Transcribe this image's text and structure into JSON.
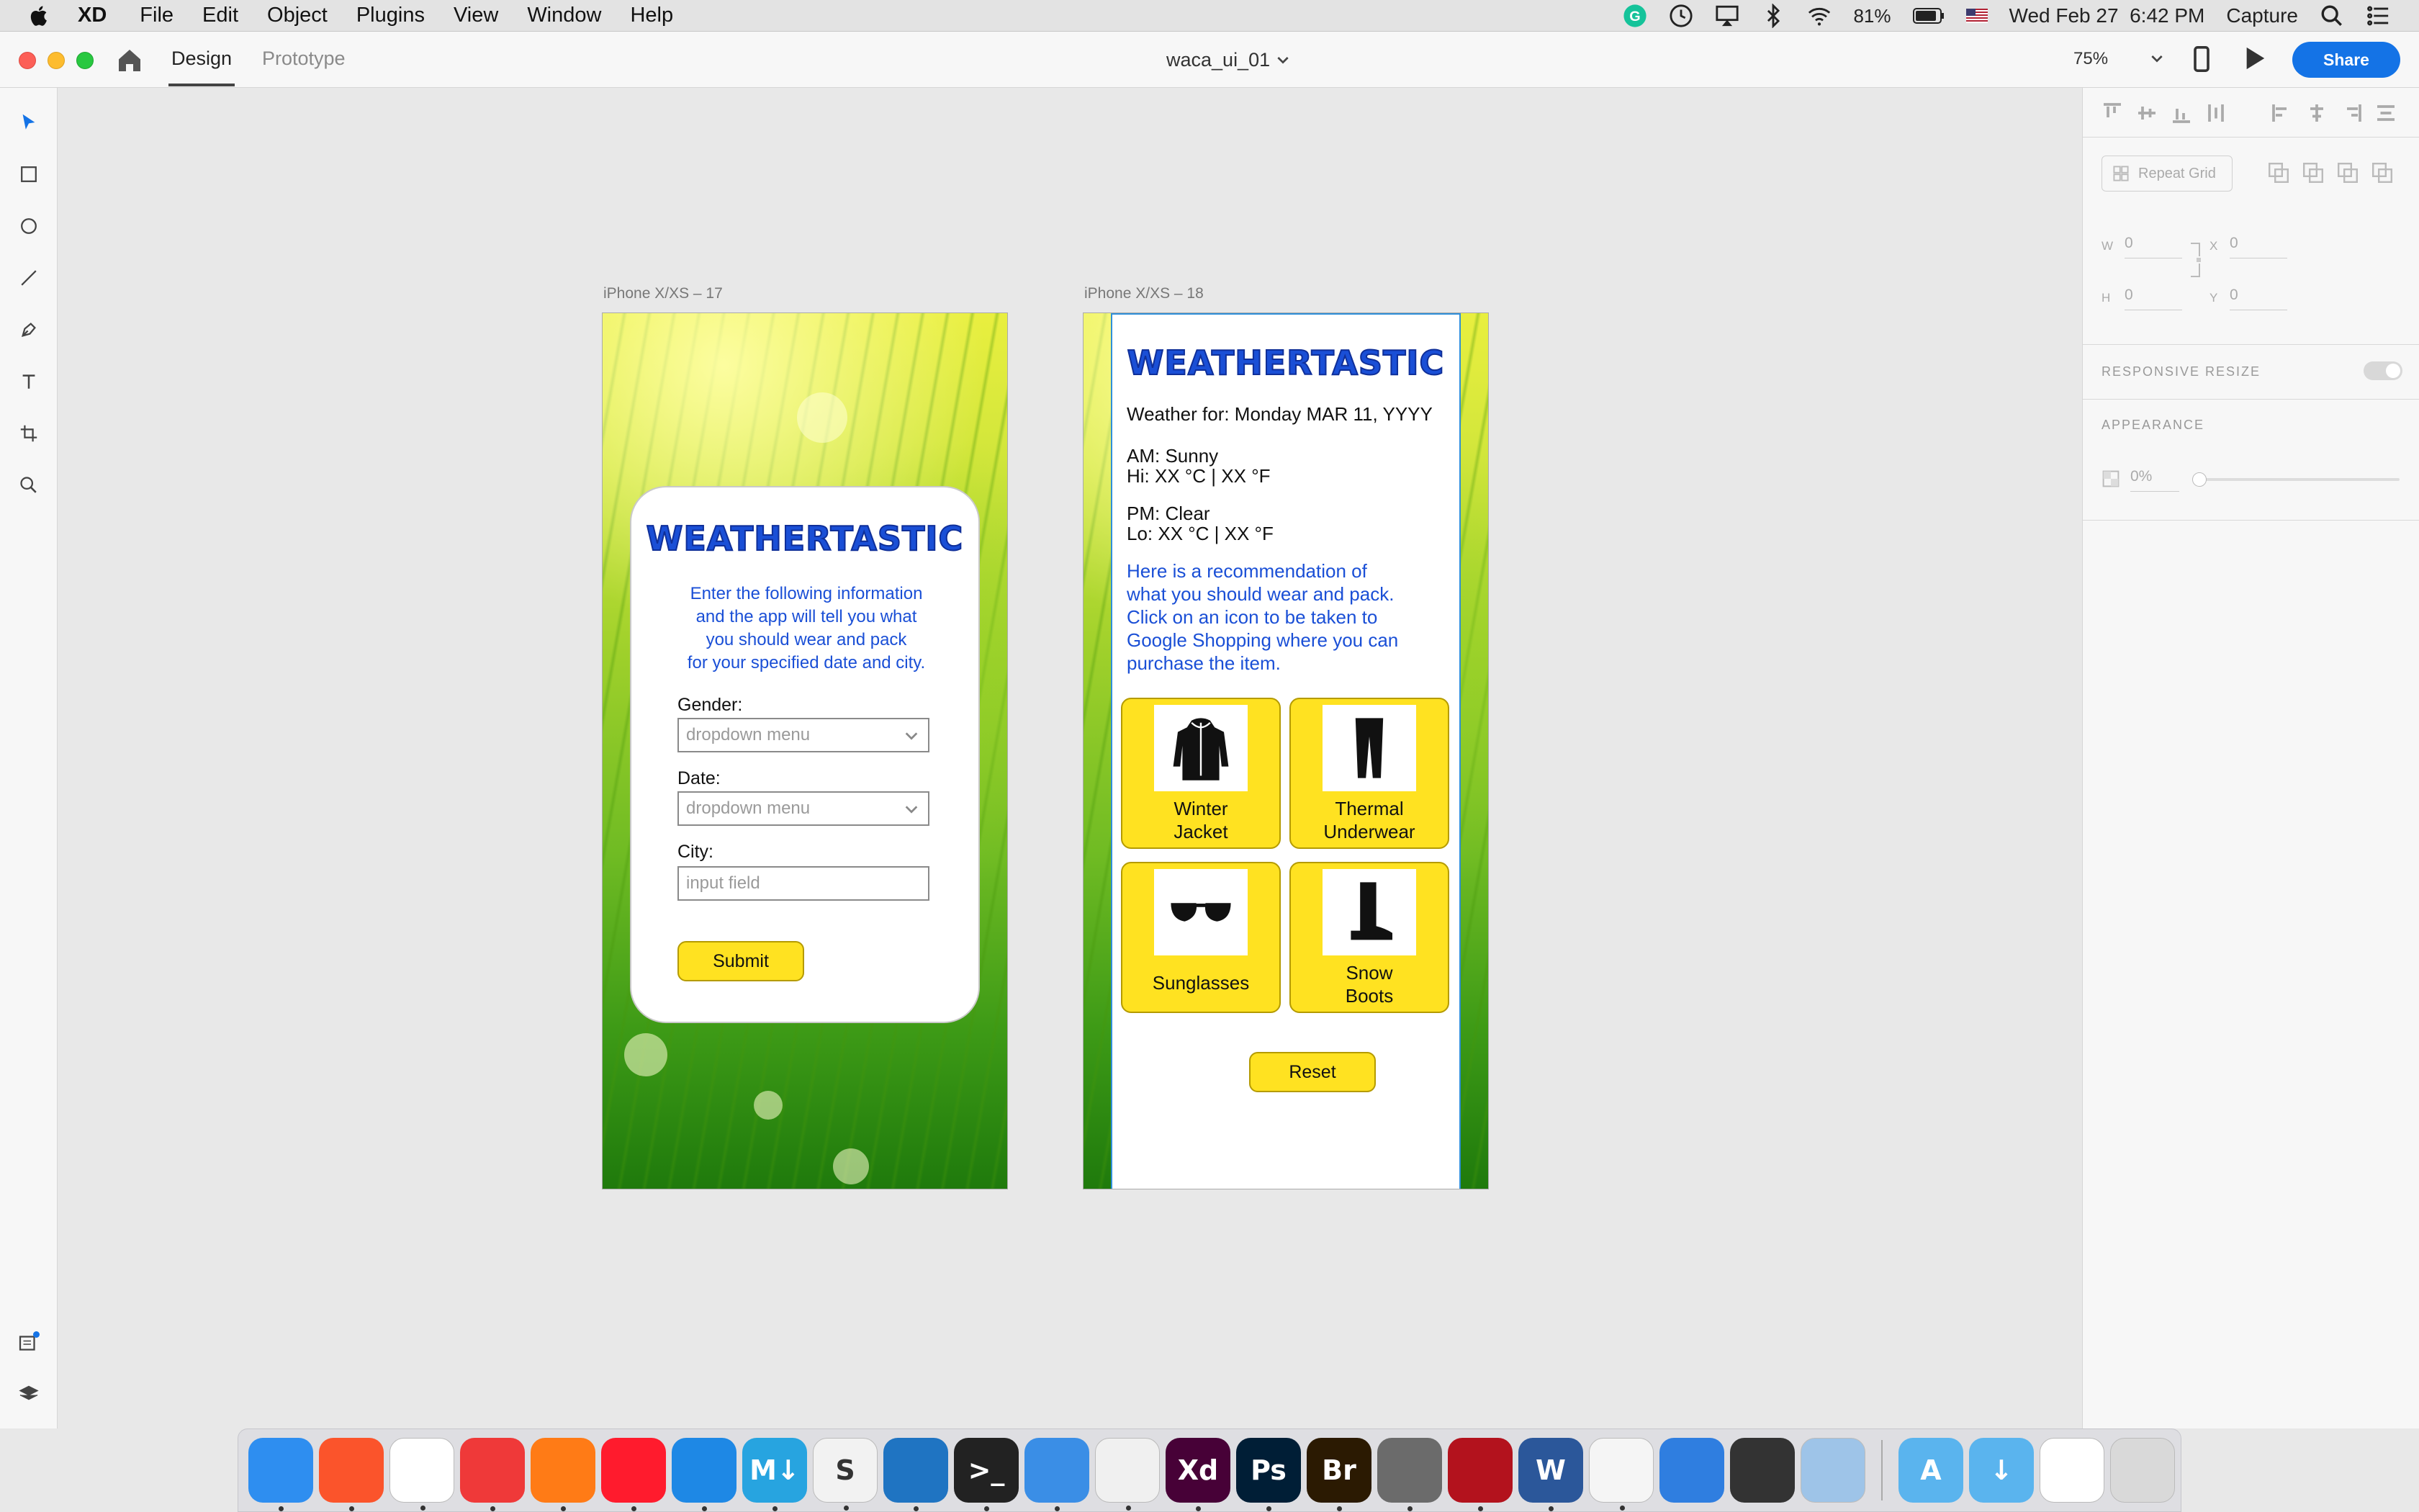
{
  "menubar": {
    "app_name": "XD",
    "menus": [
      "File",
      "Edit",
      "Object",
      "Plugins",
      "View",
      "Window",
      "Help"
    ],
    "battery": "81%",
    "datetime": "Wed Feb 27  6:42 PM",
    "capture_label": "Capture"
  },
  "titlebar": {
    "tab_design": "Design",
    "tab_prototype": "Prototype",
    "doc_title": "waca_ui_01",
    "zoom": "75%",
    "share_label": "Share"
  },
  "artboard1": {
    "label": "iPhone X/XS – 17",
    "logo": "WEATHERTASTIC",
    "intro": "Enter the following information\nand the app will tell you what\nyou should wear and pack\nfor your specified date and city.",
    "gender_label": "Gender:",
    "gender_value": "dropdown menu",
    "date_label": "Date:",
    "date_value": "dropdown menu",
    "city_label": "City:",
    "city_placeholder": "input field",
    "submit_label": "Submit"
  },
  "artboard2": {
    "label": "iPhone X/XS – 18",
    "logo": "WEATHERTASTIC",
    "weather_for": "Weather for: Monday MAR 11, YYYY",
    "am": "AM: Sunny\nHi: XX °C | XX °F",
    "pm": "PM: Clear\nLo: XX °C | XX °F",
    "recommendation": "Here is a recommendation of\nwhat you should wear and pack.\nClick on an icon to be taken to\nGoogle Shopping where you can\npurchase the item.",
    "items": [
      {
        "label": "Winter\nJacket",
        "icon": "jacket-icon"
      },
      {
        "label": "Thermal\nUnderwear",
        "icon": "leggings-icon"
      },
      {
        "label": "Sunglasses",
        "icon": "sunglasses-icon"
      },
      {
        "label": "Snow\nBoots",
        "icon": "boot-icon"
      }
    ],
    "reset_label": "Reset"
  },
  "props": {
    "repeat_grid": "Repeat Grid",
    "w_label": "W",
    "w_value": "0",
    "h_label": "H",
    "h_value": "0",
    "x_label": "X",
    "x_value": "0",
    "y_label": "Y",
    "y_value": "0",
    "responsive_resize": "RESPONSIVE RESIZE",
    "appearance": "APPEARANCE",
    "opacity_value": "0%"
  },
  "colors": {
    "accent_blue": "#1473e6",
    "logo_blue": "#1a4fd6",
    "button_yellow": "#ffe221"
  },
  "dock": {
    "apps": [
      {
        "name": "finder",
        "glyph": "",
        "color": "#2e8ef0"
      },
      {
        "name": "brave",
        "glyph": "",
        "color": "#fb542b"
      },
      {
        "name": "chrome",
        "glyph": "",
        "color": "#ffffff"
      },
      {
        "name": "vivaldi",
        "glyph": "",
        "color": "#ef3939"
      },
      {
        "name": "firefox",
        "glyph": "",
        "color": "#ff7b16"
      },
      {
        "name": "opera",
        "glyph": "",
        "color": "#ff1b2d"
      },
      {
        "name": "safari",
        "glyph": "",
        "color": "#1e88e5"
      },
      {
        "name": "markdown",
        "glyph": "M↓",
        "color": "#27a4e0"
      },
      {
        "name": "sublime",
        "glyph": "S",
        "color": "#f2f2f2"
      },
      {
        "name": "vscode",
        "glyph": "",
        "color": "#1f74c2"
      },
      {
        "name": "terminal",
        "glyph": ">_",
        "color": "#222222"
      },
      {
        "name": "xcode",
        "glyph": "",
        "color": "#3a8ee6"
      },
      {
        "name": "time-machine",
        "glyph": "",
        "color": "#f0f0f0"
      },
      {
        "name": "adobe-xd",
        "glyph": "Xd",
        "color": "#470137"
      },
      {
        "name": "photoshop",
        "glyph": "Ps",
        "color": "#001e36"
      },
      {
        "name": "bridge",
        "glyph": "Br",
        "color": "#2b1a02"
      },
      {
        "name": "color-ui",
        "glyph": "",
        "color": "#6b6b6b"
      },
      {
        "name": "photo-booth",
        "glyph": "",
        "color": "#b3121d"
      },
      {
        "name": "word",
        "glyph": "W",
        "color": "#2b579a"
      },
      {
        "name": "text-edit",
        "glyph": "",
        "color": "#f5f5f5"
      },
      {
        "name": "keynote",
        "glyph": "",
        "color": "#2f7ee0"
      },
      {
        "name": "calculator",
        "glyph": "",
        "color": "#333333"
      },
      {
        "name": "preview",
        "glyph": "",
        "color": "#9ec4e8"
      }
    ],
    "folders": [
      {
        "name": "applications-folder",
        "glyph": "A",
        "color": "#5ab4ee"
      },
      {
        "name": "downloads-folder",
        "glyph": "↓",
        "color": "#5ab4ee"
      },
      {
        "name": "screenshot-stack",
        "glyph": "",
        "color": "#ffffff"
      },
      {
        "name": "trash",
        "glyph": "",
        "color": "#d9d9d9"
      }
    ]
  }
}
